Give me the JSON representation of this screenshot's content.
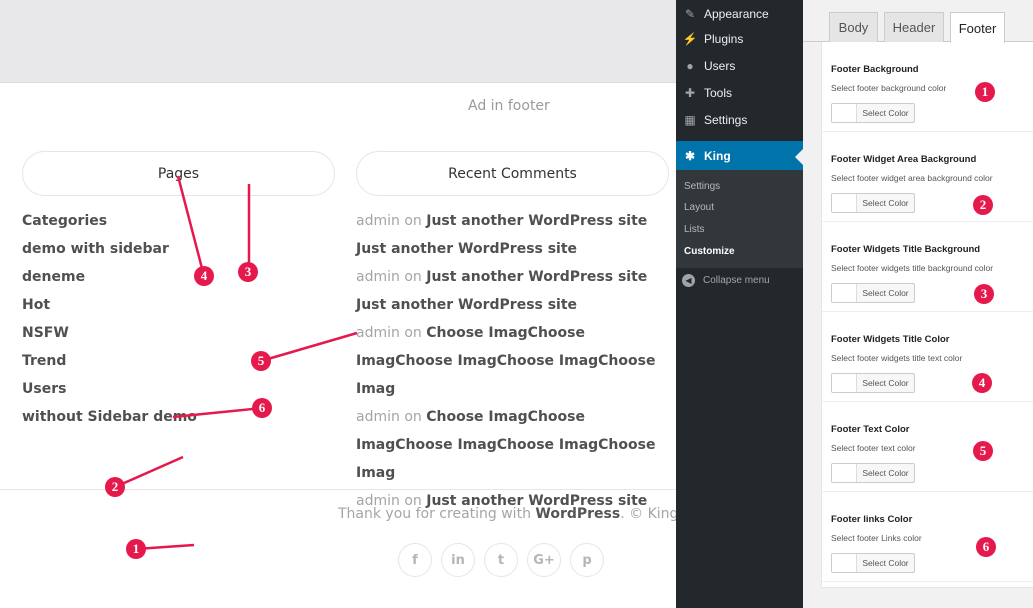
{
  "preview": {
    "ad_text": "Ad in footer",
    "pages_widget": {
      "title": "Pages",
      "items": [
        "Categories",
        "demo with sidebar",
        "deneme",
        "Hot",
        "NSFW",
        "Trend",
        "Users",
        "without Sidebar demo"
      ]
    },
    "comments_widget": {
      "title": "Recent Comments",
      "items": [
        {
          "author": "admin",
          "on": "on",
          "post": "Just another WordPress site Just another WordPress site"
        },
        {
          "author": "admin",
          "on": "on",
          "post": "Just another WordPress site Just another WordPress site"
        },
        {
          "author": "admin",
          "on": "on",
          "post": "Choose ImagChoose ImagChoose ImagChoose ImagChoose Imag"
        },
        {
          "author": "admin",
          "on": "on",
          "post": "Choose ImagChoose ImagChoose ImagChoose ImagChoose Imag"
        },
        {
          "author": "admin",
          "on": "on",
          "post": "Just another WordPress site"
        }
      ]
    },
    "footer": {
      "text_before": "Thank you for creating with ",
      "text_brand": "WordPress",
      "text_after": ". © King Press"
    },
    "socials": [
      {
        "icon": "facebook-icon",
        "glyph": "f"
      },
      {
        "icon": "linkedin-icon",
        "glyph": "in"
      },
      {
        "icon": "twitter-icon",
        "glyph": "t"
      },
      {
        "icon": "google-plus-icon",
        "glyph": "G+"
      },
      {
        "icon": "pinterest-icon",
        "glyph": "p"
      }
    ]
  },
  "annotations": [
    "1",
    "2",
    "3",
    "4",
    "5",
    "6"
  ],
  "admin_menu": {
    "items": [
      {
        "label": "Appearance",
        "icon": "paintbrush-icon"
      },
      {
        "label": "Plugins",
        "icon": "plugin-icon"
      },
      {
        "label": "Users",
        "icon": "user-icon"
      },
      {
        "label": "Tools",
        "icon": "wrench-icon"
      },
      {
        "label": "Settings",
        "icon": "settings-icon"
      }
    ],
    "active": {
      "label": "King",
      "icon": "gear-icon"
    },
    "submenu": [
      "Settings",
      "Layout",
      "Lists",
      "Customize"
    ],
    "collapse_label": "Collapse menu"
  },
  "customizer": {
    "tabs": [
      "Body",
      "Header",
      "Footer"
    ],
    "active_tab": "Footer",
    "button_label": "Select Color",
    "settings": [
      {
        "title": "Footer Background",
        "desc": "Select footer background color",
        "marker": "1"
      },
      {
        "title": "Footer Widget Area Background",
        "desc": "Select footer widget area background color",
        "marker": "2"
      },
      {
        "title": "Footer Widgets Title Background",
        "desc": "Select footer widgets title background color",
        "marker": "3"
      },
      {
        "title": "Footer Widgets Title Color",
        "desc": "Select footer widgets title text color",
        "marker": "4"
      },
      {
        "title": "Footer Text Color",
        "desc": "Select footer text color",
        "marker": "5"
      },
      {
        "title": "Footer links Color",
        "desc": "Select footer Links color",
        "marker": "6"
      }
    ]
  },
  "colors": {
    "annotation": "#e6194d",
    "admin_bg": "#23282d",
    "admin_active": "#0073aa"
  }
}
